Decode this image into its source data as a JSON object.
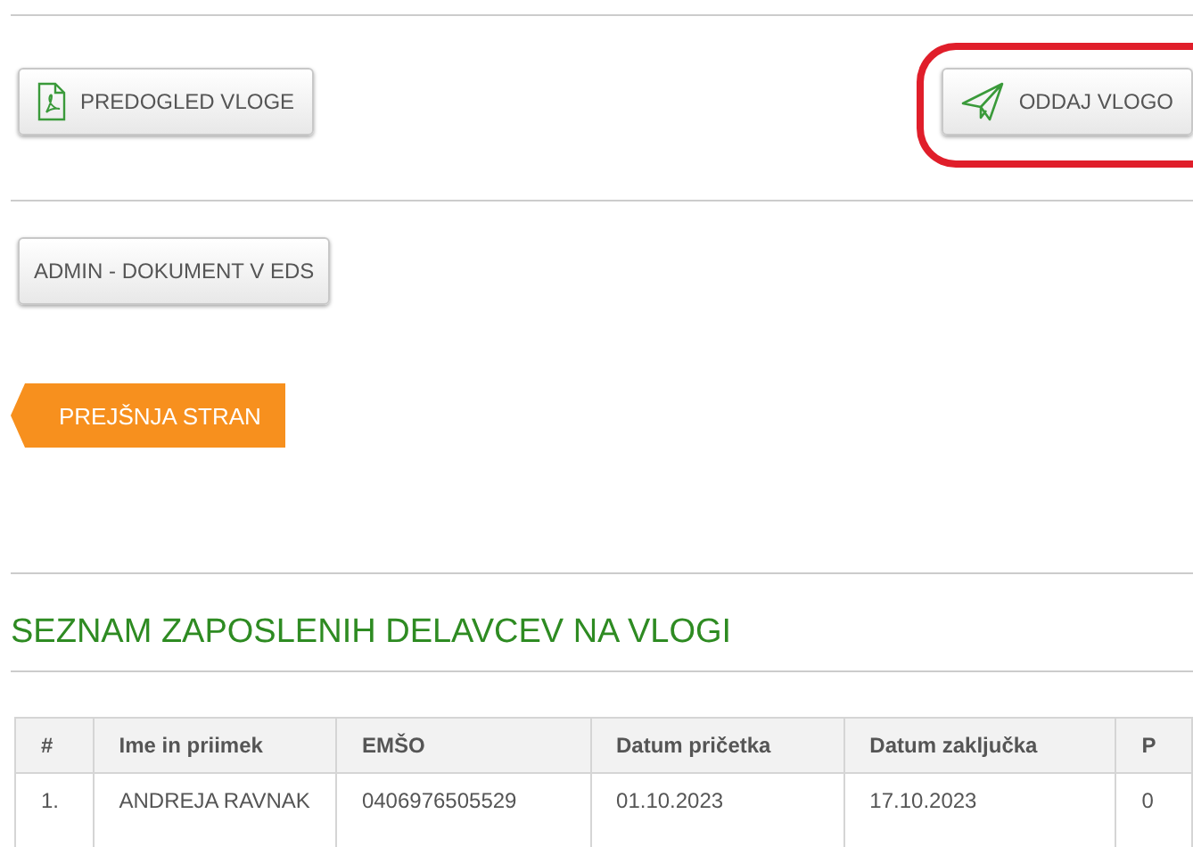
{
  "actions": [
    {
      "label": "PREDOGLED VLOGE",
      "kind": "preview",
      "highlighted": false
    },
    {
      "label": "ODDAJ VLOGO",
      "kind": "submit",
      "highlighted": true
    }
  ],
  "admin_button": {
    "label": "ADMIN - DOKUMENT V EDS"
  },
  "back_button": {
    "label": "PREJŠNJA STRAN"
  },
  "section_title": "SEZNAM ZAPOSLENIH DELAVCEV NA VLOGI",
  "table": {
    "columns": [
      "#",
      "Ime in priimek",
      "EMŠO",
      "Datum pričetka",
      "Datum zaključka",
      "P"
    ],
    "rows": [
      [
        "1.",
        "ANDREJA RAVNAK",
        "0406976505529",
        "01.10.2023",
        "17.10.2023",
        "0"
      ]
    ]
  }
}
